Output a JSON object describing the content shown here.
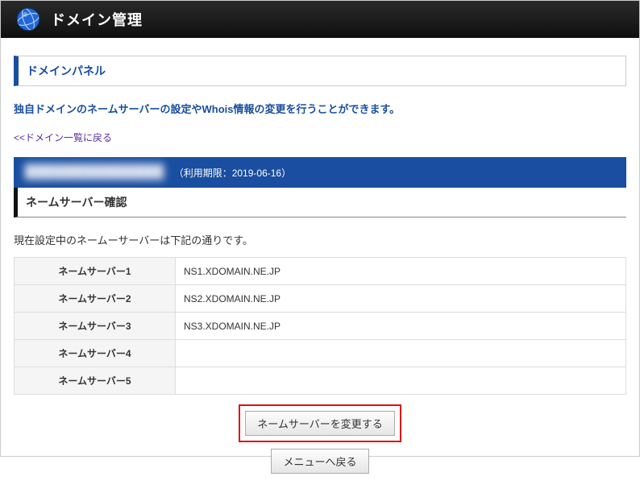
{
  "header": {
    "title": "ドメイン管理"
  },
  "panel": {
    "title": "ドメインパネル",
    "description": "独自ドメインのネームサーバーの設定やWhois情報の変更を行うことができます。",
    "back_link": "<<ドメイン一覧に戻る"
  },
  "banner": {
    "domain_hidden": "██████████████",
    "expiry_label": "（利用期限：2019-06-16）"
  },
  "section": {
    "title": "ネームサーバー確認",
    "note": "現在設定中のネームーサーバーは下記の通りです。"
  },
  "nameservers": [
    {
      "label": "ネームサーバー1",
      "value": "NS1.XDOMAIN.NE.JP"
    },
    {
      "label": "ネームサーバー2",
      "value": "NS2.XDOMAIN.NE.JP"
    },
    {
      "label": "ネームサーバー3",
      "value": "NS3.XDOMAIN.NE.JP"
    },
    {
      "label": "ネームサーバー4",
      "value": ""
    },
    {
      "label": "ネームサーバー5",
      "value": ""
    }
  ],
  "buttons": {
    "change": "ネームサーバーを変更する",
    "back_menu": "メニューへ戻る"
  }
}
